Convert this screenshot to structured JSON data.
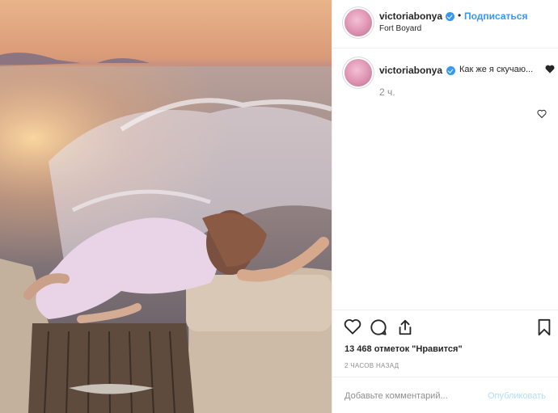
{
  "post": {
    "username": "victoriabonya",
    "follow_label": "Подписаться",
    "separator": "•",
    "location": "Fort Boyard",
    "caption": {
      "username": "victoriabonya",
      "text": "Как же я скучаю...",
      "emoji_icon": "black-heart-icon",
      "time": "2 ч."
    },
    "likes_text": "13 468 отметок \"Нравится\"",
    "posted_ago": "2 ЧАСОВ НАЗАД",
    "comment": {
      "placeholder": "Добавьте комментарий...",
      "publish_label": "Опубликовать"
    },
    "icons": [
      "heart-icon",
      "comment-icon",
      "share-icon",
      "bookmark-icon",
      "verified-icon"
    ],
    "colors": {
      "accent": "#3897f0",
      "muted": "#8e8e8e",
      "border": "#efefef",
      "publish_disabled": "#b2dffc"
    }
  }
}
